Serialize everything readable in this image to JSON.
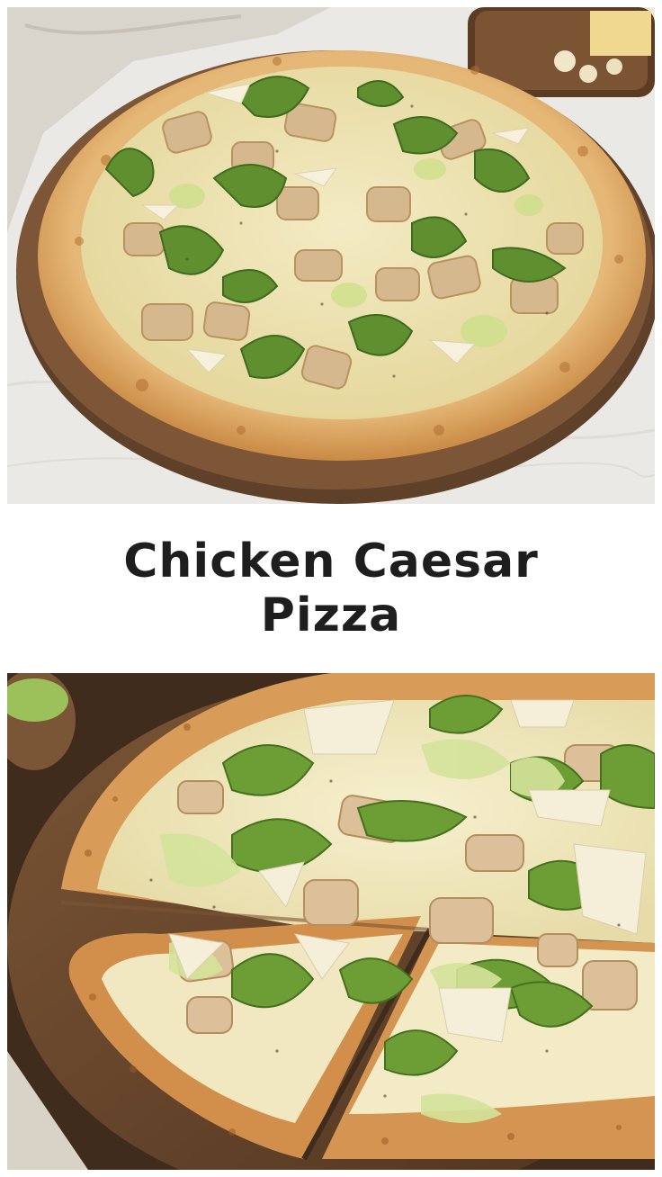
{
  "recipe": {
    "title_line1": "Chicken Caesar",
    "title_line2": "Pizza"
  },
  "images": {
    "top": "overhead-pizza-photo",
    "bottom": "sliced-pizza-closeup-photo"
  },
  "colors": {
    "background": "#ffffff",
    "title_text": "#1e1e1e",
    "crust": "#d9a25c",
    "cheese": "#efe6b8",
    "lettuce": "#6f9e3a",
    "chicken": "#d8bf98",
    "board": "#6b4a2e"
  }
}
